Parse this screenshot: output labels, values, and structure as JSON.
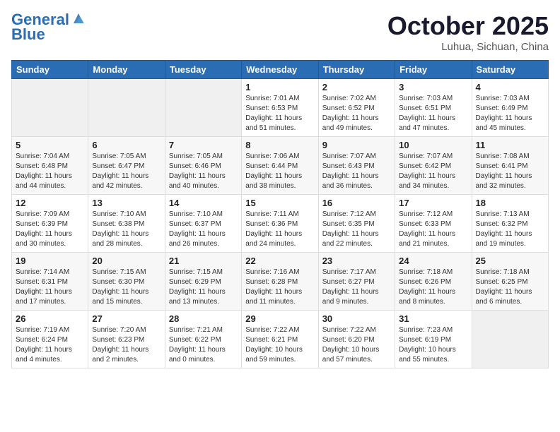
{
  "header": {
    "logo_line1": "General",
    "logo_line2": "Blue",
    "month_title": "October 2025",
    "location": "Luhua, Sichuan, China"
  },
  "weekdays": [
    "Sunday",
    "Monday",
    "Tuesday",
    "Wednesday",
    "Thursday",
    "Friday",
    "Saturday"
  ],
  "weeks": [
    [
      {
        "day": "",
        "info": ""
      },
      {
        "day": "",
        "info": ""
      },
      {
        "day": "",
        "info": ""
      },
      {
        "day": "1",
        "info": "Sunrise: 7:01 AM\nSunset: 6:53 PM\nDaylight: 11 hours\nand 51 minutes."
      },
      {
        "day": "2",
        "info": "Sunrise: 7:02 AM\nSunset: 6:52 PM\nDaylight: 11 hours\nand 49 minutes."
      },
      {
        "day": "3",
        "info": "Sunrise: 7:03 AM\nSunset: 6:51 PM\nDaylight: 11 hours\nand 47 minutes."
      },
      {
        "day": "4",
        "info": "Sunrise: 7:03 AM\nSunset: 6:49 PM\nDaylight: 11 hours\nand 45 minutes."
      }
    ],
    [
      {
        "day": "5",
        "info": "Sunrise: 7:04 AM\nSunset: 6:48 PM\nDaylight: 11 hours\nand 44 minutes."
      },
      {
        "day": "6",
        "info": "Sunrise: 7:05 AM\nSunset: 6:47 PM\nDaylight: 11 hours\nand 42 minutes."
      },
      {
        "day": "7",
        "info": "Sunrise: 7:05 AM\nSunset: 6:46 PM\nDaylight: 11 hours\nand 40 minutes."
      },
      {
        "day": "8",
        "info": "Sunrise: 7:06 AM\nSunset: 6:44 PM\nDaylight: 11 hours\nand 38 minutes."
      },
      {
        "day": "9",
        "info": "Sunrise: 7:07 AM\nSunset: 6:43 PM\nDaylight: 11 hours\nand 36 minutes."
      },
      {
        "day": "10",
        "info": "Sunrise: 7:07 AM\nSunset: 6:42 PM\nDaylight: 11 hours\nand 34 minutes."
      },
      {
        "day": "11",
        "info": "Sunrise: 7:08 AM\nSunset: 6:41 PM\nDaylight: 11 hours\nand 32 minutes."
      }
    ],
    [
      {
        "day": "12",
        "info": "Sunrise: 7:09 AM\nSunset: 6:39 PM\nDaylight: 11 hours\nand 30 minutes."
      },
      {
        "day": "13",
        "info": "Sunrise: 7:10 AM\nSunset: 6:38 PM\nDaylight: 11 hours\nand 28 minutes."
      },
      {
        "day": "14",
        "info": "Sunrise: 7:10 AM\nSunset: 6:37 PM\nDaylight: 11 hours\nand 26 minutes."
      },
      {
        "day": "15",
        "info": "Sunrise: 7:11 AM\nSunset: 6:36 PM\nDaylight: 11 hours\nand 24 minutes."
      },
      {
        "day": "16",
        "info": "Sunrise: 7:12 AM\nSunset: 6:35 PM\nDaylight: 11 hours\nand 22 minutes."
      },
      {
        "day": "17",
        "info": "Sunrise: 7:12 AM\nSunset: 6:33 PM\nDaylight: 11 hours\nand 21 minutes."
      },
      {
        "day": "18",
        "info": "Sunrise: 7:13 AM\nSunset: 6:32 PM\nDaylight: 11 hours\nand 19 minutes."
      }
    ],
    [
      {
        "day": "19",
        "info": "Sunrise: 7:14 AM\nSunset: 6:31 PM\nDaylight: 11 hours\nand 17 minutes."
      },
      {
        "day": "20",
        "info": "Sunrise: 7:15 AM\nSunset: 6:30 PM\nDaylight: 11 hours\nand 15 minutes."
      },
      {
        "day": "21",
        "info": "Sunrise: 7:15 AM\nSunset: 6:29 PM\nDaylight: 11 hours\nand 13 minutes."
      },
      {
        "day": "22",
        "info": "Sunrise: 7:16 AM\nSunset: 6:28 PM\nDaylight: 11 hours\nand 11 minutes."
      },
      {
        "day": "23",
        "info": "Sunrise: 7:17 AM\nSunset: 6:27 PM\nDaylight: 11 hours\nand 9 minutes."
      },
      {
        "day": "24",
        "info": "Sunrise: 7:18 AM\nSunset: 6:26 PM\nDaylight: 11 hours\nand 8 minutes."
      },
      {
        "day": "25",
        "info": "Sunrise: 7:18 AM\nSunset: 6:25 PM\nDaylight: 11 hours\nand 6 minutes."
      }
    ],
    [
      {
        "day": "26",
        "info": "Sunrise: 7:19 AM\nSunset: 6:24 PM\nDaylight: 11 hours\nand 4 minutes."
      },
      {
        "day": "27",
        "info": "Sunrise: 7:20 AM\nSunset: 6:23 PM\nDaylight: 11 hours\nand 2 minutes."
      },
      {
        "day": "28",
        "info": "Sunrise: 7:21 AM\nSunset: 6:22 PM\nDaylight: 11 hours\nand 0 minutes."
      },
      {
        "day": "29",
        "info": "Sunrise: 7:22 AM\nSunset: 6:21 PM\nDaylight: 10 hours\nand 59 minutes."
      },
      {
        "day": "30",
        "info": "Sunrise: 7:22 AM\nSunset: 6:20 PM\nDaylight: 10 hours\nand 57 minutes."
      },
      {
        "day": "31",
        "info": "Sunrise: 7:23 AM\nSunset: 6:19 PM\nDaylight: 10 hours\nand 55 minutes."
      },
      {
        "day": "",
        "info": ""
      }
    ]
  ]
}
